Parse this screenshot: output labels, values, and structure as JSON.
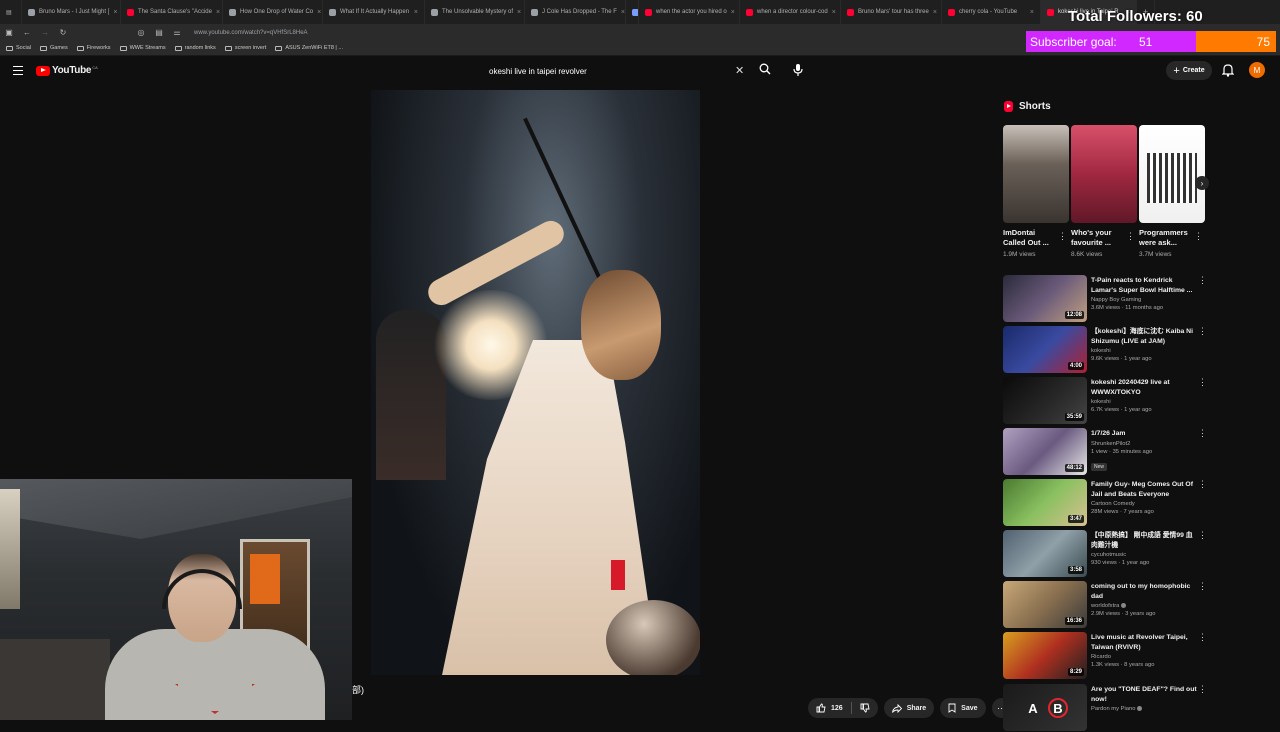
{
  "browser": {
    "tabs": [
      {
        "label": "Bruno Mars - I Just Might [",
        "color": "#9aa0a6"
      },
      {
        "label": "The Santa Clause's \"Accide",
        "color": "#ff0033"
      },
      {
        "label": "How One Drop of Water Co",
        "color": "#9aa0a6"
      },
      {
        "label": "What If It Actually Happen",
        "color": "#9aa0a6"
      },
      {
        "label": "The Unsolvable Mystery of",
        "color": "#9aa0a6"
      },
      {
        "label": "J Cole Has Dropped - The F",
        "color": "#9aa0a6"
      },
      {
        "label": "",
        "color": "#7b9cff"
      },
      {
        "label": "when the actor you hired o",
        "color": "#ff0033"
      },
      {
        "label": "when a director colour-cod",
        "color": "#ff0033"
      },
      {
        "label": "Bruno Mars' tour has three",
        "color": "#ff0033"
      },
      {
        "label": "cherry cola - YouTube",
        "color": "#ff0033"
      },
      {
        "label": "kokeshi live in Taipei R",
        "color": "#ff0033"
      }
    ],
    "url": "www.youtube.com/watch?v=qVHfSrL8HeA",
    "bookmarks": [
      "Social",
      "Games",
      "Fireworks",
      "WWE Streams",
      "random links",
      "screen invert",
      "ASUS ZenWiFi ET8 | ..."
    ]
  },
  "overlay": {
    "followers_text": "Total Followers: 60",
    "sub_goal_label": "Subscriber goal:",
    "sub_goal_current": "51",
    "sub_goal_target": "75",
    "sub_goal_fraction": 0.68,
    "caption": "部)",
    "a_label": "A",
    "b_label": "B"
  },
  "youtube": {
    "logo_text": "YouTube",
    "country": "CA",
    "search_value": "okeshi live in taipei revolver",
    "create_label": "Create",
    "avatar_letter": "M",
    "like_count": "126",
    "share_label": "Share",
    "save_label": "Save"
  },
  "shorts": {
    "heading": "Shorts",
    "items": [
      {
        "title": "ImDontai Called Out ...",
        "views": "1.9M views"
      },
      {
        "title": "Who's your favourite ...",
        "views": "8.6K views"
      },
      {
        "title": "Programmers were ask...",
        "views": "3.7M views"
      }
    ]
  },
  "recommendations": [
    {
      "title": "T-Pain reacts to Kendrick Lamar's Super Bowl Halftime ...",
      "channel": "Nappy Boy Gaming",
      "meta": "3.6M views · 11 months ago",
      "duration": "12:08",
      "verified": false,
      "badge": ""
    },
    {
      "title": "【kokeshi】海底に沈む Kaiba Ni Shizumu (LIVE at JAM)",
      "channel": "kokeshi",
      "meta": "9.6K views · 1 year ago",
      "duration": "4:00",
      "verified": false,
      "badge": ""
    },
    {
      "title": "kokeshi 20240429 live at WWWX/TOKYO",
      "channel": "kokeshi",
      "meta": "6.7K views · 1 year ago",
      "duration": "35:59",
      "verified": false,
      "badge": ""
    },
    {
      "title": "1/7/26 Jam",
      "channel": "ShrunkenPilot2",
      "meta": "1 view · 35 minutes ago",
      "duration": "48:12",
      "verified": false,
      "badge": "New"
    },
    {
      "title": "Family Guy- Meg Comes Out Of Jail and Beats Everyone",
      "channel": "Cartoon Comedy",
      "meta": "28M views · 7 years ago",
      "duration": "3:47",
      "verified": false,
      "badge": ""
    },
    {
      "title": "【中原熱搞】 剛中成語 愛情99 血肉難汁機",
      "channel": "cycuhotmusic",
      "meta": "930 views · 1 year ago",
      "duration": "3:58",
      "verified": false,
      "badge": ""
    },
    {
      "title": "coming out to my homophobic dad",
      "channel": "worldofxtra",
      "meta": "2.9M views · 3 years ago",
      "duration": "16:36",
      "verified": true,
      "badge": ""
    },
    {
      "title": "Live music at Revolver Taipei, Taiwan (RVIVR)",
      "channel": "Ricardo",
      "meta": "1.3K views · 8 years ago",
      "duration": "8:29",
      "verified": false,
      "badge": ""
    },
    {
      "title": "Are you \"TONE DEAF\"? Find out now!",
      "channel": "Pardon my Piano",
      "meta": "",
      "duration": "",
      "verified": true,
      "badge": ""
    }
  ]
}
